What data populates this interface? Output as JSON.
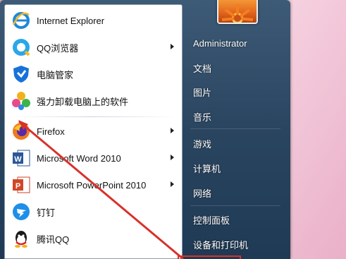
{
  "programs": [
    {
      "label": "Internet Explorer",
      "icon": "internet-explorer-icon",
      "submenu": false
    },
    {
      "label": "QQ浏览器",
      "icon": "qq-browser-icon",
      "submenu": true
    },
    {
      "label": "电脑管家",
      "icon": "pc-manager-icon",
      "submenu": false
    },
    {
      "label": "强力卸载电脑上的软件",
      "icon": "uninstaller-icon",
      "submenu": false
    },
    {
      "label": "Firefox",
      "icon": "firefox-icon",
      "submenu": true
    },
    {
      "label": "Microsoft Word 2010",
      "icon": "word-icon",
      "submenu": true
    },
    {
      "label": "Microsoft PowerPoint 2010",
      "icon": "powerpoint-icon",
      "submenu": true
    },
    {
      "label": "钉钉",
      "icon": "dingtalk-icon",
      "submenu": false
    },
    {
      "label": "腾讯QQ",
      "icon": "qq-icon",
      "submenu": false
    }
  ],
  "right_items": [
    {
      "label": "Administrator"
    },
    {
      "label": "文档"
    },
    {
      "label": "图片"
    },
    {
      "label": "音乐"
    },
    {
      "label": "游戏"
    },
    {
      "label": "计算机"
    },
    {
      "label": "网络"
    },
    {
      "label": "控制面板"
    },
    {
      "label": "设备和打印机"
    }
  ],
  "colors": {
    "annotation_arrow": "#d8312b",
    "menu_background": "#2a4560",
    "desktop_background": "#f3c7da"
  }
}
